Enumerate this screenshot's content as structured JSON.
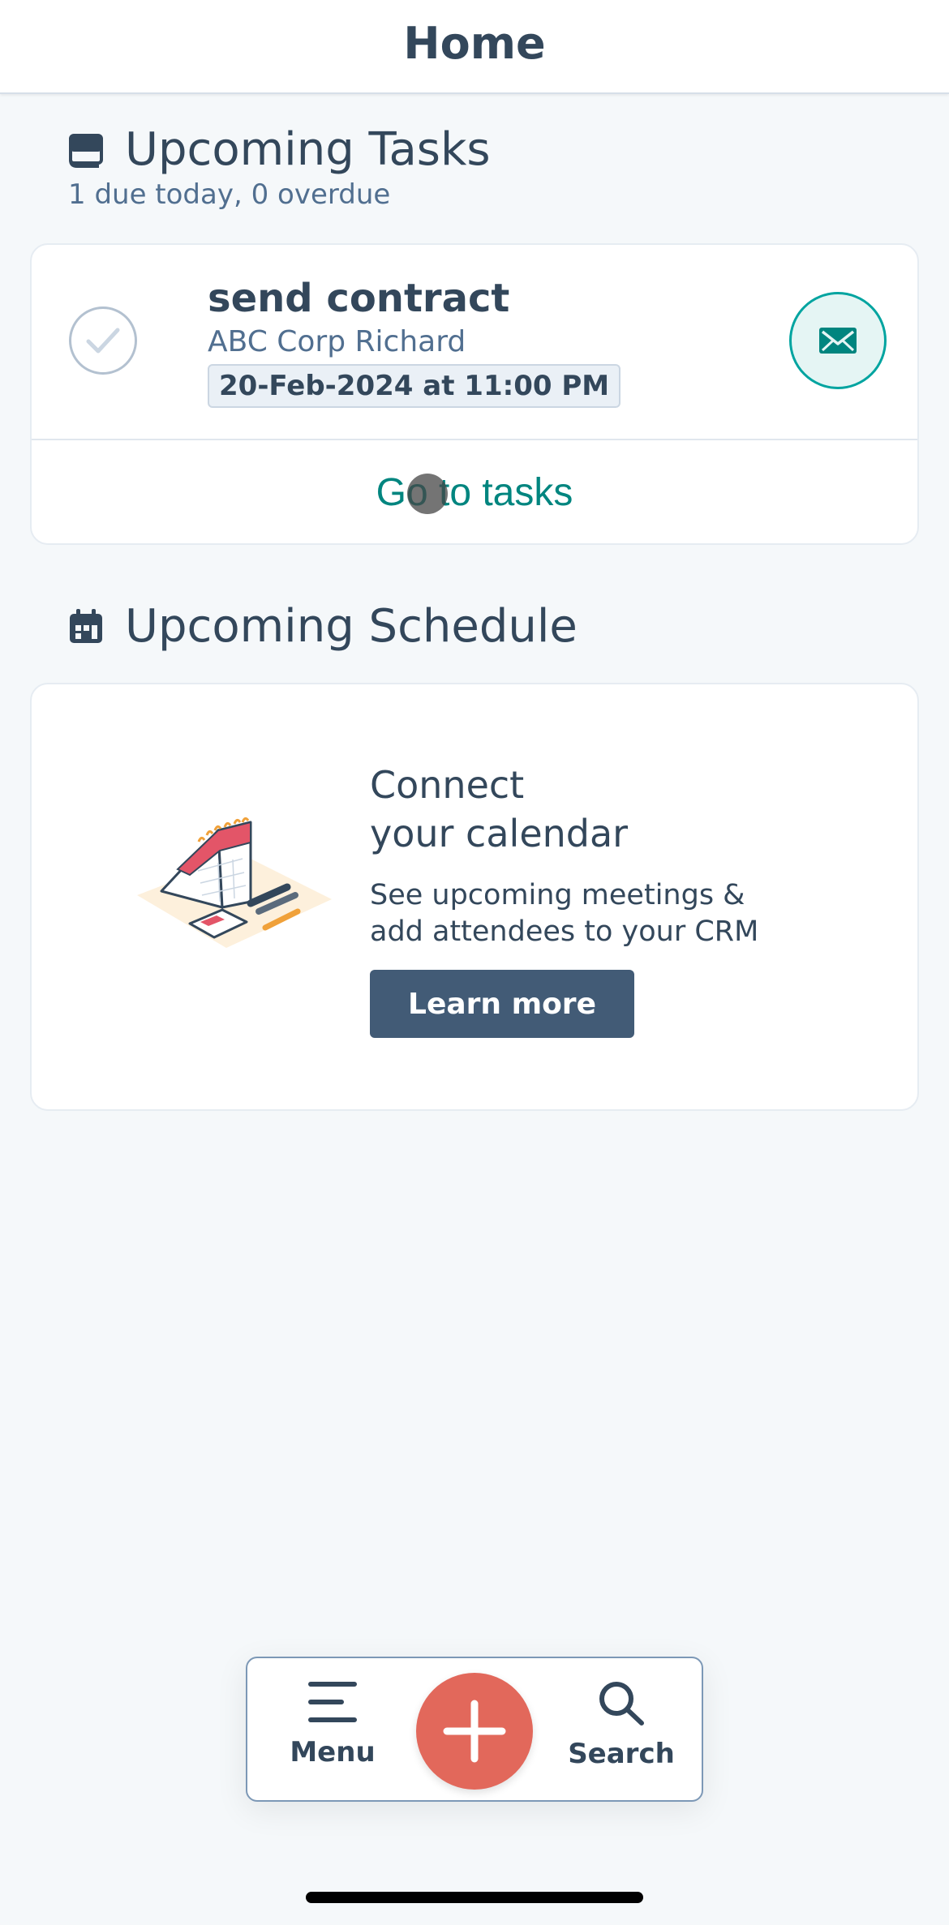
{
  "header": {
    "title": "Home"
  },
  "tasks_section": {
    "title": "Upcoming Tasks",
    "subtitle": "1 due today, 0 overdue",
    "icon": "tasks-icon",
    "task": {
      "title": "send contract",
      "company": "ABC Corp Richard",
      "due": "20-Feb-2024 at 11:00 PM",
      "action_icon": "email-icon"
    },
    "link_label": "Go to tasks"
  },
  "schedule_section": {
    "title": "Upcoming Schedule",
    "icon": "calendar-icon",
    "card": {
      "title_line1": "Connect",
      "title_line2": "your calendar",
      "desc_line1": "See upcoming meetings &",
      "desc_line2": "add attendees to your CRM",
      "button_label": "Learn more"
    }
  },
  "bottom_nav": {
    "menu_label": "Menu",
    "search_label": "Search",
    "add_icon": "plus-icon"
  },
  "colors": {
    "accent_teal": "#00a4a0",
    "fab": "#e2685b",
    "button": "#425b76",
    "text": "#33475b"
  }
}
